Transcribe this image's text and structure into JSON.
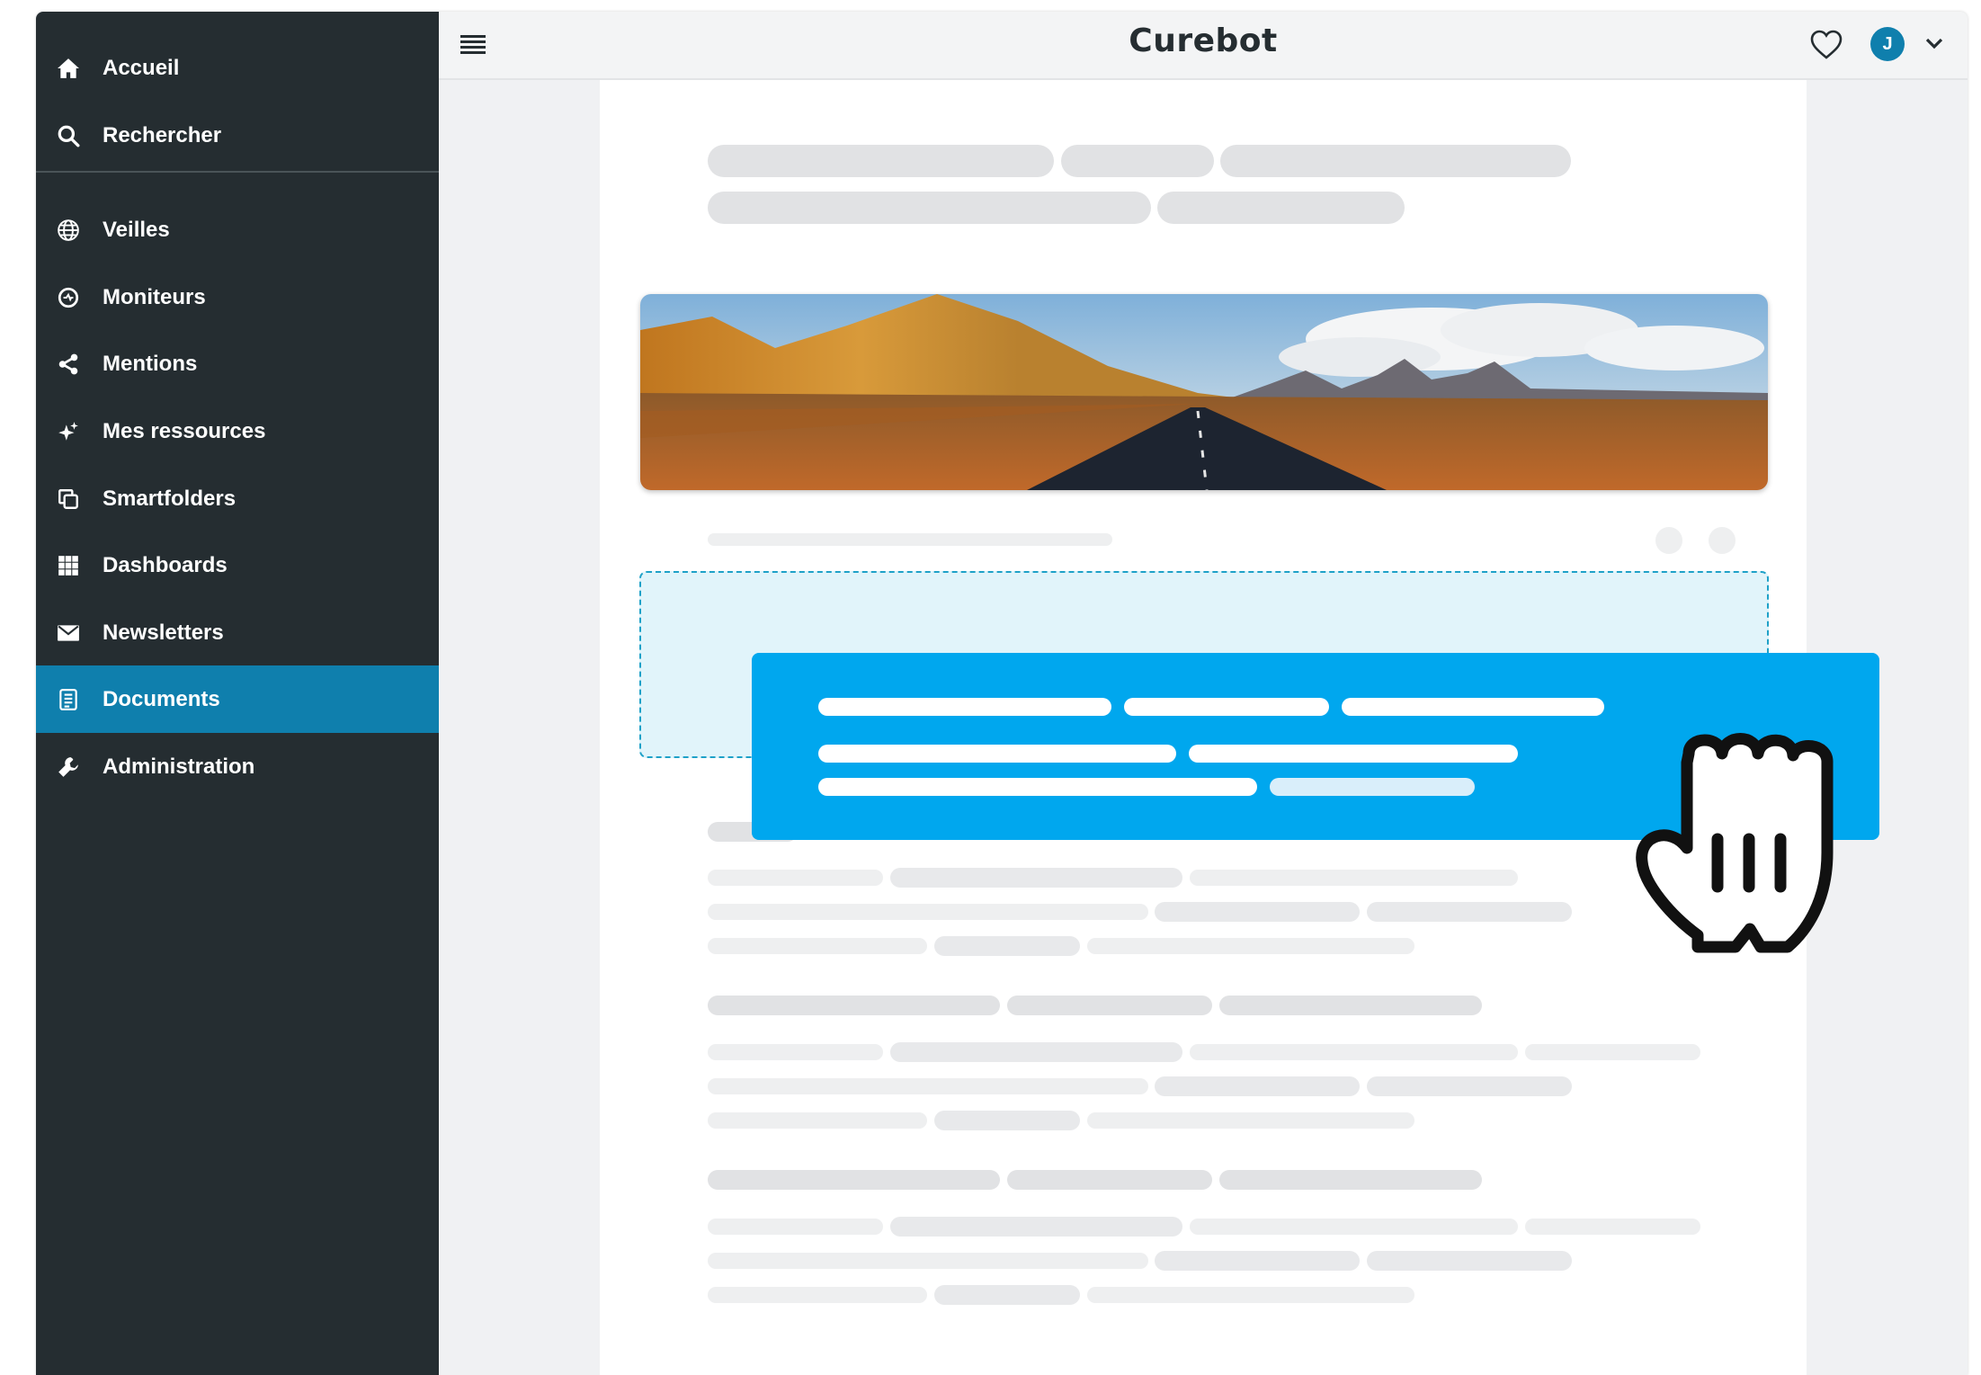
{
  "app": {
    "brand": "Curebot",
    "user_initial": "J"
  },
  "colors": {
    "sidebar": "#252d31",
    "active": "#0f7fad",
    "accent": "#00a7ee",
    "drop_zone": "#e1f4fa"
  },
  "sidebar": {
    "items": [
      {
        "label": "Accueil",
        "icon": "home-icon"
      },
      {
        "label": "Rechercher",
        "icon": "search-icon"
      },
      {
        "label": "Veilles",
        "icon": "globe-icon"
      },
      {
        "label": "Moniteurs",
        "icon": "monitor-icon"
      },
      {
        "label": "Mentions",
        "icon": "share-icon"
      },
      {
        "label": "Mes ressources",
        "icon": "sparkle-icon"
      },
      {
        "label": "Smartfolders",
        "icon": "copy-icon"
      },
      {
        "label": "Dashboards",
        "icon": "grid-icon"
      },
      {
        "label": "Newsletters",
        "icon": "envelope-icon"
      },
      {
        "label": "Documents",
        "icon": "document-icon",
        "active": true
      },
      {
        "label": "Administration",
        "icon": "wrench-icon"
      }
    ]
  },
  "topbar": {
    "menu_icon": "hamburger-icon",
    "favorite_icon": "heart-icon",
    "dropdown_icon": "chevron-down-icon"
  },
  "content": {
    "hero_image": "mountain-road-landscape",
    "drag_cursor_icon": "grab-hand-icon"
  }
}
